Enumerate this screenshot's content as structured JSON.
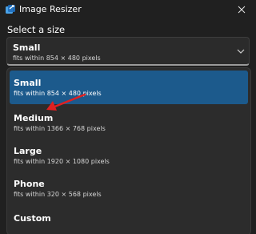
{
  "window": {
    "title": "Image Resizer",
    "icon": "app-icon",
    "close_icon": "close-icon"
  },
  "select_label": "Select a size",
  "combobox": {
    "selected_name": "Small",
    "selected_desc": "fits within 854 × 480 pixels",
    "chevron_icon": "chevron-down-icon"
  },
  "options": [
    {
      "name": "Small",
      "desc": "fits within 854 × 480 pixels",
      "selected": true
    },
    {
      "name": "Medium",
      "desc": "fits within 1366 × 768 pixels",
      "selected": false
    },
    {
      "name": "Large",
      "desc": "fits within 1920 × 1080 pixels",
      "selected": false
    },
    {
      "name": "Phone",
      "desc": "fits within 320 × 568 pixels",
      "selected": false
    },
    {
      "name": "Custom",
      "desc": "",
      "selected": false
    }
  ],
  "colors": {
    "background": "#202020",
    "selected_item": "#1c5a8c",
    "annotation_arrow": "#e02020"
  }
}
